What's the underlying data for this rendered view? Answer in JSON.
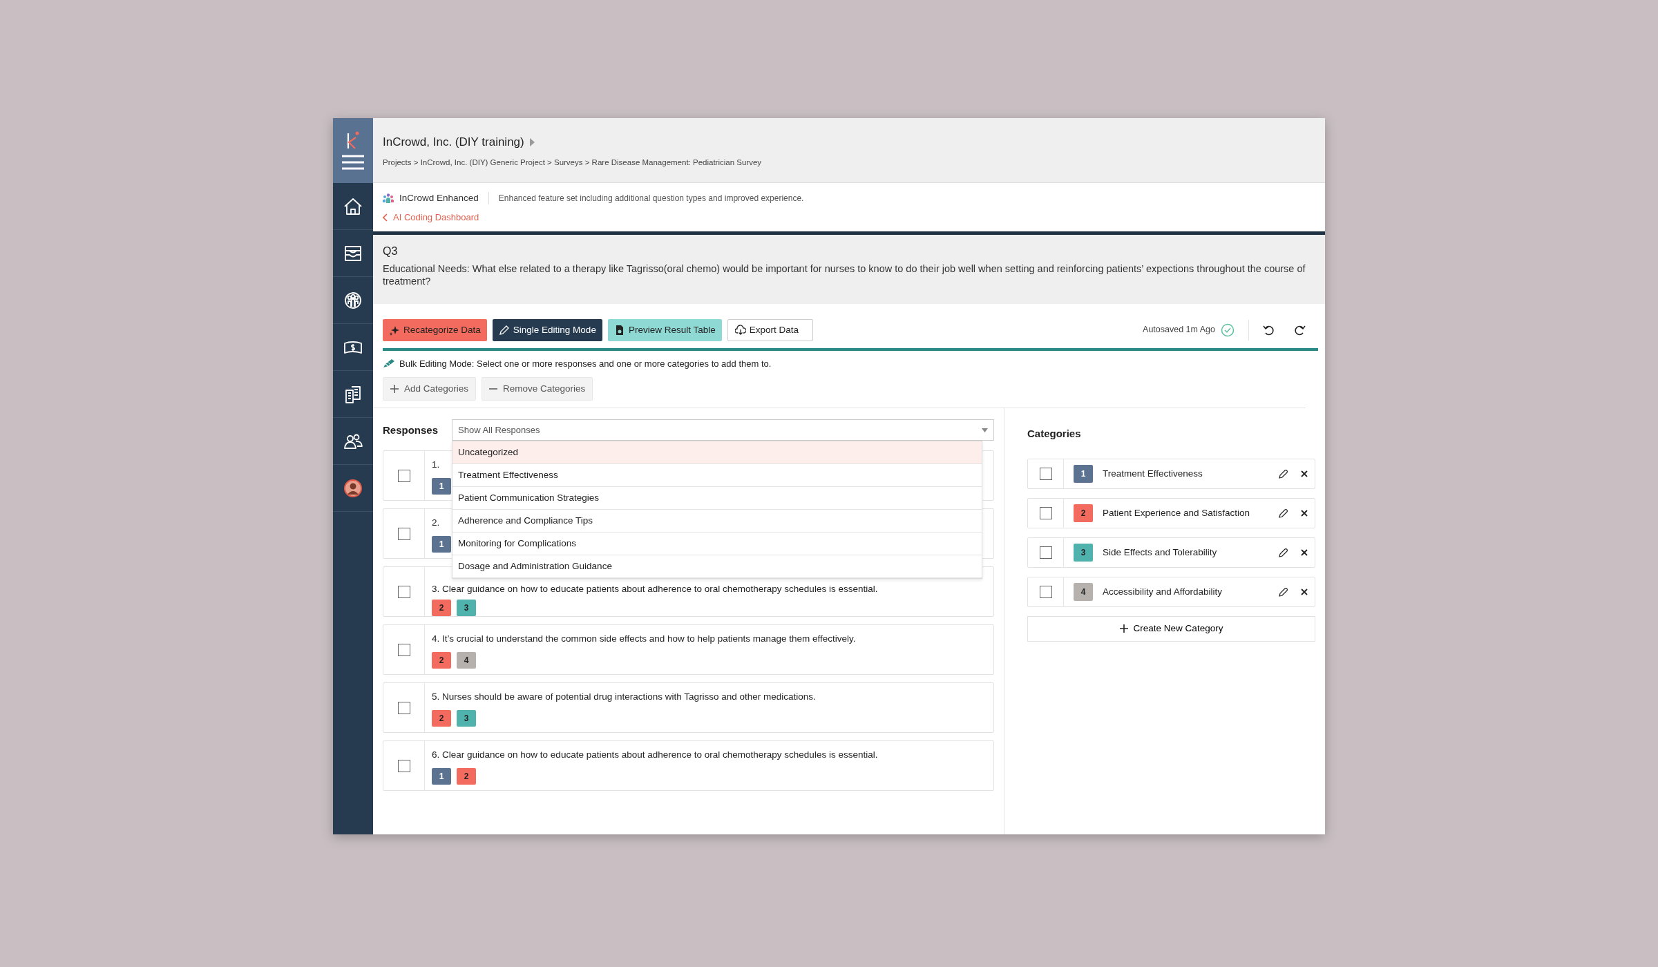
{
  "header": {
    "title": "InCrowd, Inc. (DIY training)",
    "breadcrumb": "Projects > InCrowd, Inc. (DIY) Generic Project > Surveys > Rare Disease Management: Pediatrician Survey"
  },
  "feature": {
    "name": "InCrowd Enhanced",
    "description": "Enhanced feature set including additional question types and improved experience."
  },
  "back_link": "AI Coding Dashboard",
  "question": {
    "number": "Q3",
    "text": "Educational Needs: What else related to a therapy like Tagrisso(oral chemo) would be important for nurses to know to do their job well when setting and reinforcing patients’ expections throughout the course of treatment?"
  },
  "toolbar": {
    "buttons": [
      {
        "label": "Recategorize Data",
        "kind": "recategorize"
      },
      {
        "label": "Single Editing Mode",
        "kind": "single"
      },
      {
        "label": "Preview Result Table",
        "kind": "preview"
      },
      {
        "label": "Export Data",
        "kind": "export"
      }
    ],
    "autosave": "Autosaved 1m Ago"
  },
  "bulk_note": "Bulk Editing Mode: Select one or more responses and one or more categories to add them to.",
  "bulk_actions": [
    {
      "label": "Add Categories",
      "kind": "add"
    },
    {
      "label": "Remove Categories",
      "kind": "remove"
    }
  ],
  "responses": {
    "label": "Responses",
    "filter": {
      "value": "Show All Responses",
      "expanded": true,
      "options": [
        {
          "label": "Uncategorized",
          "selected": true
        },
        {
          "label": "Treatment Effectiveness",
          "selected": false
        },
        {
          "label": "Patient Communication Strategies",
          "selected": false
        },
        {
          "label": "Adherence and Compliance Tips",
          "selected": false
        },
        {
          "label": "Monitoring for Complications",
          "selected": false
        },
        {
          "label": "Dosage and Administration Guidance",
          "selected": false
        }
      ]
    },
    "items": [
      {
        "text": "1.",
        "checked": false,
        "tags": [
          {
            "label": "1",
            "color": "#5b7391"
          }
        ]
      },
      {
        "text": "2.",
        "checked": false,
        "tags": [
          {
            "label": "1",
            "color": "#5b7391"
          }
        ]
      },
      {
        "text": "3. Clear guidance on how to educate patients about adherence to oral chemotherapy schedules is essential.",
        "checked": false,
        "tags": [
          {
            "label": "2",
            "color": "#f36b5e"
          },
          {
            "label": "3",
            "color": "#4fb2ad"
          }
        ]
      },
      {
        "text": "4. It’s crucial to understand the common side effects and how to help patients manage them effectively.",
        "checked": false,
        "tags": [
          {
            "label": "2",
            "color": "#f36b5e"
          },
          {
            "label": "4",
            "color": "#b6b1ad"
          }
        ]
      },
      {
        "text": "5. Nurses should be aware of potential drug interactions with Tagrisso and other medications.",
        "checked": false,
        "tags": [
          {
            "label": "2",
            "color": "#f36b5e"
          },
          {
            "label": "3",
            "color": "#4fb2ad"
          }
        ]
      },
      {
        "text": "6. Clear guidance on how to educate patients about adherence to oral chemotherapy schedules is essential.",
        "checked": false,
        "tags": [
          {
            "label": "1",
            "color": "#5b7391"
          },
          {
            "label": "2",
            "color": "#f36b5e"
          }
        ]
      }
    ]
  },
  "categories": {
    "title": "Categories",
    "items": [
      {
        "number": "1",
        "name": "Treatment Effectiveness",
        "color": "#5b7391",
        "checked": false
      },
      {
        "number": "2",
        "name": "Patient Experience and Satisfaction",
        "color": "#f36b5e",
        "checked": false
      },
      {
        "number": "3",
        "name": "Side Effects and Tolerability",
        "color": "#4fb2ad",
        "checked": false
      },
      {
        "number": "4",
        "name": "Accessibility and Affordability",
        "color": "#b6b1ad",
        "checked": false
      }
    ],
    "create_label": "Create New Category"
  }
}
